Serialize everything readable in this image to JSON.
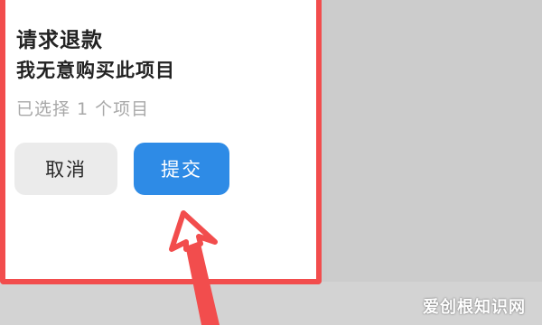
{
  "dialog": {
    "title": "请求退款",
    "reason": "我无意购买此项目",
    "selected_count_text": "已选择 1 个项目",
    "cancel_label": "取消",
    "submit_label": "提交"
  },
  "annotation": {
    "highlight_color": "#f24d4d",
    "arrow_target": "submit-button"
  },
  "watermark": {
    "text": "爱创根知识网"
  },
  "colors": {
    "submit_bg": "#2e8be6",
    "cancel_bg": "#ebebeb"
  }
}
